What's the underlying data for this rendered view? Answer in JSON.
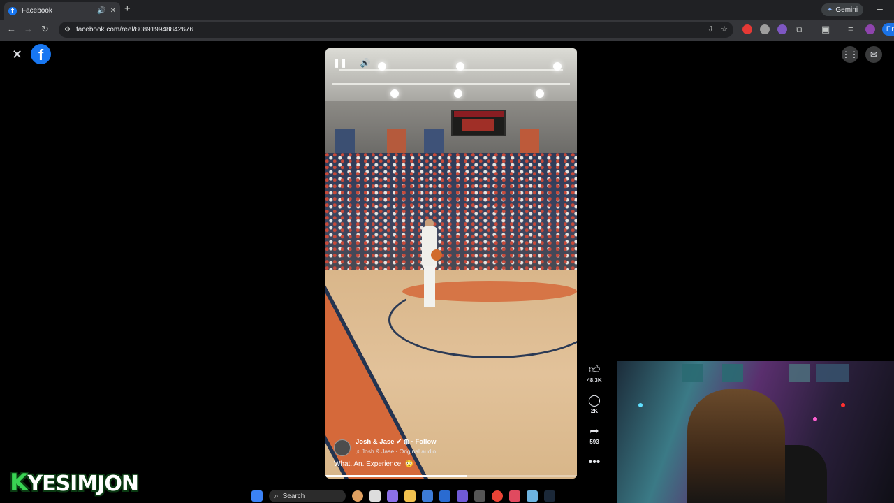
{
  "browser": {
    "tab": {
      "title": "Facebook",
      "favicon": "facebook-icon"
    },
    "url": "facebook.com/reel/808919948842676",
    "gemini_label": "Gemini",
    "profile_label": "Fin"
  },
  "reel": {
    "author": "Josh & Jase",
    "follow_label": "Follow",
    "audio": "Josh & Jase · Original audio",
    "caption": "What. An. Experience. 😳",
    "progress_fraction": 0.56,
    "actions": {
      "likes": "48.3K",
      "comments": "2K",
      "shares": "593"
    }
  },
  "overlay": {
    "streamer_initial": "K",
    "streamer_name": "YESIMJON"
  },
  "taskbar": {
    "search_label": "Search"
  },
  "colors": {
    "facebook_blue": "#1877f2",
    "streamer_green": "#39d353",
    "court_orange": "#d5693a",
    "court_navy": "#233451"
  }
}
